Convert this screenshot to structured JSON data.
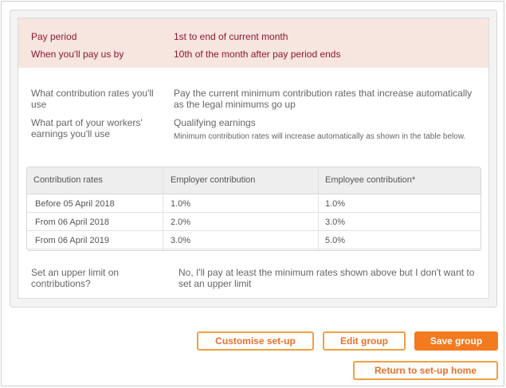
{
  "pay": {
    "period_label": "Pay period",
    "period_value": "1st to end of current month",
    "when_label": "When you'll pay us by",
    "when_value": "10th of the month after pay period ends"
  },
  "info": {
    "rates_label": "What contribution rates you'll use",
    "rates_value": "Pay the current minimum contribution rates that increase automatically as the legal minimums go up",
    "earnings_label": "What part of your workers' earnings you'll use",
    "earnings_value": "Qualifying earnings",
    "earnings_note": "Minimum contribution rates will increase automatically as shown in the table below.",
    "limit_label": "Set an upper limit on contributions?",
    "limit_value": "No, I'll pay at least the minimum rates shown above but I don't want to set an upper limit"
  },
  "table": {
    "headers": [
      "Contribution rates",
      "Employer contribution",
      "Employee contribution*"
    ],
    "rows": [
      [
        "Before 05 April 2018",
        "1.0%",
        "1.0%"
      ],
      [
        "From 06 April 2018",
        "2.0%",
        "3.0%"
      ],
      [
        "From 06 April 2019",
        "3.0%",
        "5.0%"
      ]
    ]
  },
  "buttons": {
    "customise": "Customise set-up",
    "edit": "Edit group",
    "save": "Save group",
    "return": "Return to set-up home"
  },
  "colors": {
    "accent": "#f47a1f",
    "pay_text": "#8b1a2e",
    "pay_band": "#f7e5e0"
  }
}
